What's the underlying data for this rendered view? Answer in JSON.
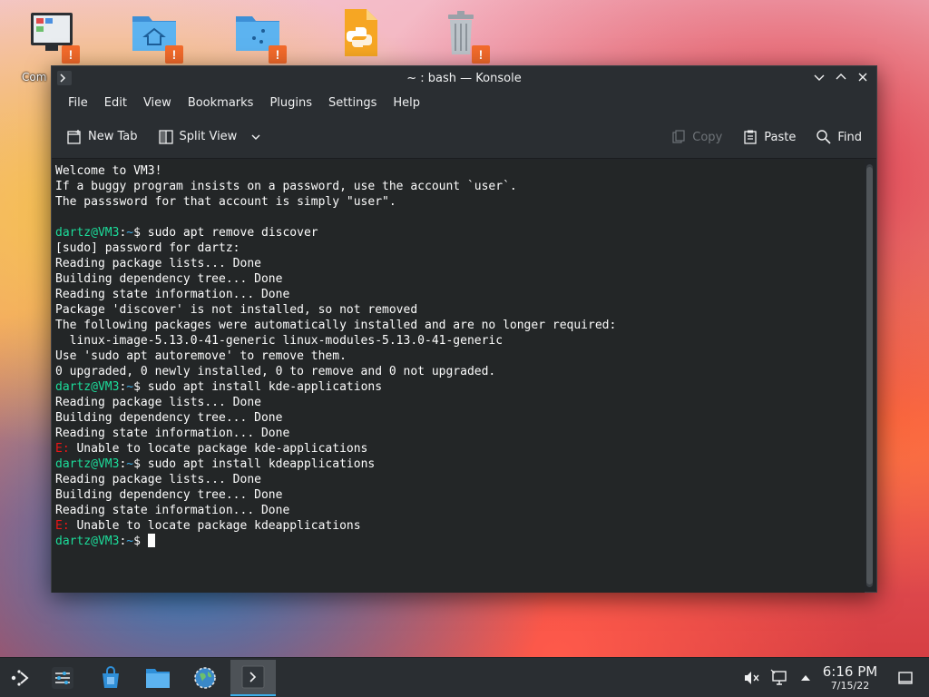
{
  "desktop": {
    "computer_label": "Com"
  },
  "window": {
    "title": "~ : bash — Konsole"
  },
  "menu": [
    "File",
    "Edit",
    "View",
    "Bookmarks",
    "Plugins",
    "Settings",
    "Help"
  ],
  "toolbar": {
    "new_tab": "New Tab",
    "split_view": "Split View",
    "copy": "Copy",
    "paste": "Paste",
    "find": "Find"
  },
  "terminal": {
    "user": "dartz@VM3",
    "path": "~",
    "lines": [
      {
        "t": "text",
        "s": "Welcome to VM3!"
      },
      {
        "t": "text",
        "s": "If a buggy program insists on a password, use the account `user`."
      },
      {
        "t": "text",
        "s": "The passsword for that account is simply \"user\"."
      },
      {
        "t": "text",
        "s": ""
      },
      {
        "t": "cmd",
        "s": "sudo apt remove discover"
      },
      {
        "t": "text",
        "s": "[sudo] password for dartz:"
      },
      {
        "t": "text",
        "s": "Reading package lists... Done"
      },
      {
        "t": "text",
        "s": "Building dependency tree... Done"
      },
      {
        "t": "text",
        "s": "Reading state information... Done"
      },
      {
        "t": "text",
        "s": "Package 'discover' is not installed, so not removed"
      },
      {
        "t": "text",
        "s": "The following packages were automatically installed and are no longer required:"
      },
      {
        "t": "text",
        "s": "  linux-image-5.13.0-41-generic linux-modules-5.13.0-41-generic"
      },
      {
        "t": "text",
        "s": "Use 'sudo apt autoremove' to remove them."
      },
      {
        "t": "text",
        "s": "0 upgraded, 0 newly installed, 0 to remove and 0 not upgraded."
      },
      {
        "t": "cmd",
        "s": "sudo apt install kde-applications"
      },
      {
        "t": "text",
        "s": "Reading package lists... Done"
      },
      {
        "t": "text",
        "s": "Building dependency tree... Done"
      },
      {
        "t": "text",
        "s": "Reading state information... Done"
      },
      {
        "t": "err",
        "s": "Unable to locate package kde-applications"
      },
      {
        "t": "cmd",
        "s": "sudo apt install kdeapplications"
      },
      {
        "t": "text",
        "s": "Reading package lists... Done"
      },
      {
        "t": "text",
        "s": "Building dependency tree... Done"
      },
      {
        "t": "text",
        "s": "Reading state information... Done"
      },
      {
        "t": "err",
        "s": "Unable to locate package kdeapplications"
      },
      {
        "t": "prompt",
        "s": ""
      }
    ]
  },
  "taskbar": {
    "time": "6:16 PM",
    "date": "7/15/22"
  },
  "colors": {
    "prompt_user": "#1cdc9a",
    "prompt_path": "#3daee9",
    "error": "#ed1515",
    "accent": "#3daee9"
  }
}
